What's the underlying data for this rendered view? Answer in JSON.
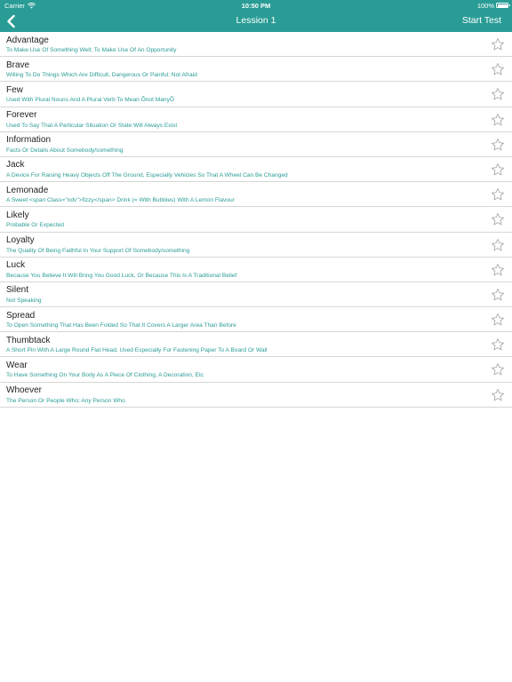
{
  "status_bar": {
    "carrier": "Carrier",
    "time": "10:50 PM",
    "battery": "100%"
  },
  "nav": {
    "title": "Lession 1",
    "action": "Start Test"
  },
  "colors": {
    "accent": "#2a9c96",
    "divider": "#d6d6d6",
    "star_outline": "#9a9a9a"
  },
  "words": [
    {
      "word": "Advantage",
      "definition": "To Make Use Of Something Well; To Make Use Of An Opportunity"
    },
    {
      "word": "Brave",
      "definition": "Willing To Do Things Which Are Difficult, Dangerous Or Painful; Not Afraid"
    },
    {
      "word": "Few",
      "definition": "Used With Plural Nouns And A Plural Verb To Mean Õnot ManyÕ"
    },
    {
      "word": "Forever",
      "definition": "Used To Say That A Particular Situation Or State Will Always Exist"
    },
    {
      "word": "Information",
      "definition": "Facts Or Details About Somebody/something"
    },
    {
      "word": "Jack",
      "definition": "A Device For Raising Heavy Objects Off The Ground, Especially Vehicles So That A Wheel Can Be Changed"
    },
    {
      "word": "Lemonade",
      "definition": "A Sweet <span Class=\"ndv\">fizzy</span> Drink (= With Bubbles) With A Lemon Flavour"
    },
    {
      "word": "Likely",
      "definition": "Probable Or Expected"
    },
    {
      "word": "Loyalty",
      "definition": "The Quality Of Being Faithful In Your Support Of Somebody/something"
    },
    {
      "word": "Luck",
      "definition": "Because You Believe It Will Bring You Good Luck, Or Because This Is A Traditional Belief"
    },
    {
      "word": "Silent",
      "definition": "Not Speaking"
    },
    {
      "word": "Spread",
      "definition": "To Open Something That Has Been Folded So That It Covers A Larger Area Than Before"
    },
    {
      "word": "Thumbtack",
      "definition": "A Short Pin With A Large Round Flat Head, Used Especially For Fastening Paper To A Board Or Wall"
    },
    {
      "word": "Wear",
      "definition": "To Have Something On Your Body As A Piece Of Clothing, A Decoration, Etc"
    },
    {
      "word": "Whoever",
      "definition": "The Person Or People Who; Any Person Who"
    }
  ]
}
